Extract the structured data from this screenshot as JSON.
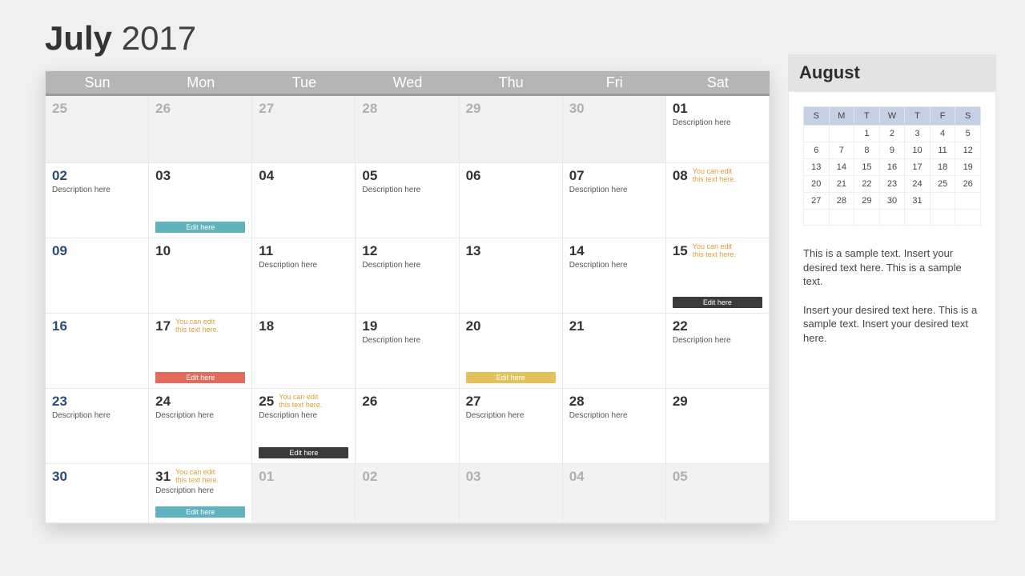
{
  "title": {
    "month": "July",
    "year": "2017"
  },
  "weekdays": [
    "Sun",
    "Mon",
    "Tue",
    "Wed",
    "Thu",
    "Fri",
    "Sat"
  ],
  "cells": [
    {
      "n": "25",
      "other": true,
      "firstrow": true
    },
    {
      "n": "26",
      "other": true,
      "firstrow": true
    },
    {
      "n": "27",
      "other": true,
      "firstrow": true
    },
    {
      "n": "28",
      "other": true,
      "firstrow": true
    },
    {
      "n": "29",
      "other": true,
      "firstrow": true
    },
    {
      "n": "30",
      "other": true,
      "firstrow": true
    },
    {
      "n": "01",
      "firstrow": true,
      "desc": "Description here"
    },
    {
      "n": "02",
      "sun": true,
      "desc": "Description here"
    },
    {
      "n": "03",
      "bar": "Edit here",
      "barColor": "teal"
    },
    {
      "n": "04"
    },
    {
      "n": "05",
      "desc": "Description here"
    },
    {
      "n": "06"
    },
    {
      "n": "07",
      "desc": "Description here"
    },
    {
      "n": "08",
      "side": "You can edit this text here."
    },
    {
      "n": "09",
      "sun": true
    },
    {
      "n": "10"
    },
    {
      "n": "11",
      "desc": "Description here"
    },
    {
      "n": "12",
      "desc": "Description here"
    },
    {
      "n": "13"
    },
    {
      "n": "14",
      "desc": "Description here"
    },
    {
      "n": "15",
      "side": "You can edit this text here.",
      "bar": "Edit here",
      "barColor": "dark"
    },
    {
      "n": "16",
      "sun": true
    },
    {
      "n": "17",
      "side": "You can edit this text here.",
      "bar": "Edit here",
      "barColor": "red"
    },
    {
      "n": "18"
    },
    {
      "n": "19",
      "desc": "Description here"
    },
    {
      "n": "20",
      "bar": "Edit here",
      "barColor": "yellow"
    },
    {
      "n": "21"
    },
    {
      "n": "22",
      "desc": "Description here"
    },
    {
      "n": "23",
      "sun": true,
      "desc": "Description here"
    },
    {
      "n": "24",
      "desc": "Description here"
    },
    {
      "n": "25",
      "side": "You can edit this text here.",
      "desc": "Description here",
      "bar": "Edit here",
      "barColor": "dark"
    },
    {
      "n": "26"
    },
    {
      "n": "27",
      "desc": "Description here"
    },
    {
      "n": "28",
      "desc": "Description here"
    },
    {
      "n": "29"
    },
    {
      "n": "30",
      "sun": true,
      "short": true
    },
    {
      "n": "31",
      "short": true,
      "side": "You can edit this text here.",
      "desc": "Description here",
      "bar": "Edit here",
      "barColor": "teal"
    },
    {
      "n": "01",
      "other": true,
      "short": true
    },
    {
      "n": "02",
      "other": true,
      "short": true
    },
    {
      "n": "03",
      "other": true,
      "short": true
    },
    {
      "n": "04",
      "other": true,
      "short": true
    },
    {
      "n": "05",
      "other": true,
      "short": true
    }
  ],
  "side": {
    "title": "August",
    "miniHeaders": [
      "S",
      "M",
      "T",
      "W",
      "T",
      "F",
      "S"
    ],
    "miniRows": [
      [
        "",
        "",
        "1",
        "2",
        "3",
        "4",
        "5"
      ],
      [
        "6",
        "7",
        "8",
        "9",
        "10",
        "11",
        "12"
      ],
      [
        "13",
        "14",
        "15",
        "16",
        "17",
        "18",
        "19"
      ],
      [
        "20",
        "21",
        "22",
        "23",
        "24",
        "25",
        "26"
      ],
      [
        "27",
        "28",
        "29",
        "30",
        "31",
        "",
        ""
      ],
      [
        "",
        "",
        "",
        "",
        "",
        "",
        ""
      ]
    ],
    "para1": "This is a sample text. Insert your desired text here. This is a sample text.",
    "para2": "Insert your desired text here. This is a sample text. Insert your desired text here."
  }
}
